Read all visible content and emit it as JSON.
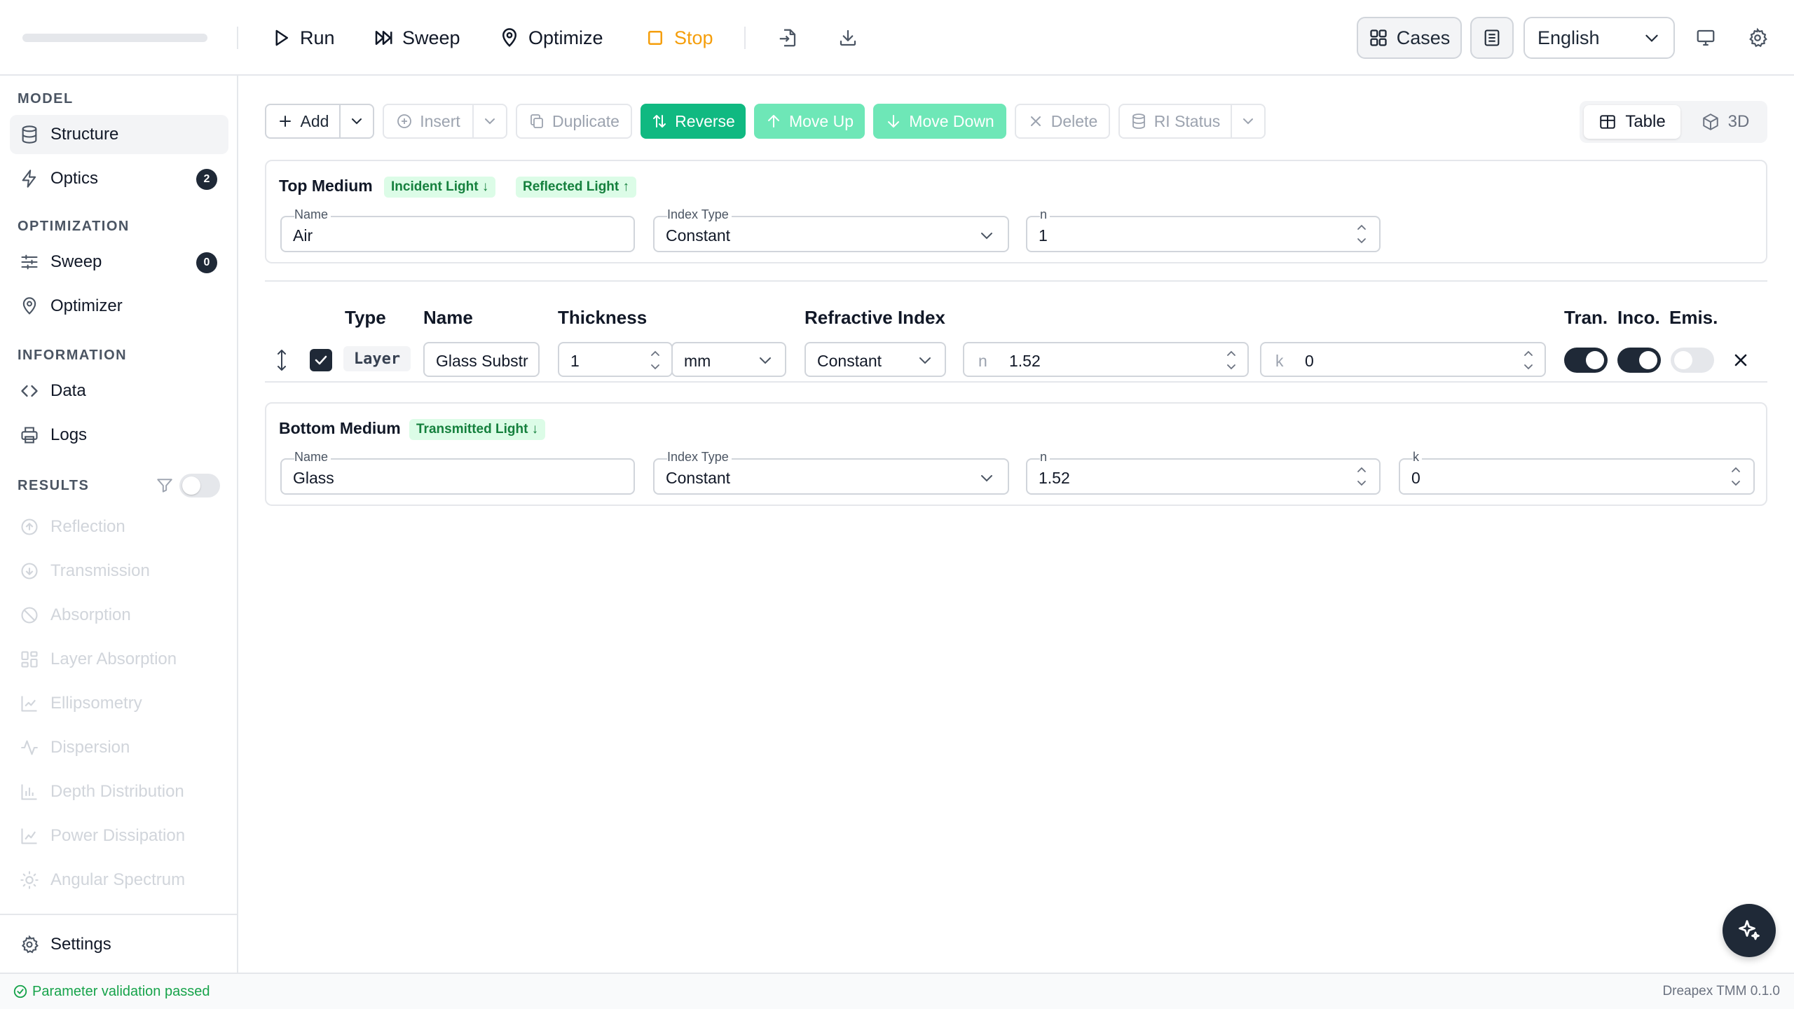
{
  "toolbar": {
    "run": "Run",
    "sweep": "Sweep",
    "optimize": "Optimize",
    "stop": "Stop",
    "cases": "Cases",
    "language": "English"
  },
  "sidebar": {
    "model_header": "MODEL",
    "optimization_header": "OPTIMIZATION",
    "information_header": "INFORMATION",
    "results_header": "RESULTS",
    "items": {
      "structure": "Structure",
      "optics": "Optics",
      "optics_badge": "2",
      "sweep": "Sweep",
      "sweep_badge": "0",
      "optimizer": "Optimizer",
      "data": "Data",
      "logs": "Logs"
    },
    "results": [
      "Reflection",
      "Transmission",
      "Absorption",
      "Layer Absorption",
      "Ellipsometry",
      "Dispersion",
      "Depth Distribution",
      "Power Dissipation",
      "Angular Spectrum"
    ],
    "settings": "Settings"
  },
  "actions": {
    "add": "Add",
    "insert": "Insert",
    "duplicate": "Duplicate",
    "reverse": "Reverse",
    "move_up": "Move Up",
    "move_down": "Move Down",
    "delete": "Delete",
    "ri_status": "RI Status",
    "view_table": "Table",
    "view_3d": "3D"
  },
  "top_medium": {
    "title": "Top Medium",
    "badge_incident": "Incident Light ↓",
    "badge_reflected": "Reflected Light ↑",
    "name_label": "Name",
    "name_value": "Air",
    "index_type_label": "Index Type",
    "index_type_value": "Constant",
    "n_label": "n",
    "n_value": "1"
  },
  "table": {
    "headers": {
      "type": "Type",
      "name": "Name",
      "thickness": "Thickness",
      "refractive_index": "Refractive Index",
      "tran": "Tran.",
      "inco": "Inco.",
      "emis": "Emis."
    },
    "row": {
      "type": "Layer",
      "name": "Glass Substr",
      "thickness": "1",
      "unit": "mm",
      "index_type": "Constant",
      "n_prefix": "n",
      "n_value": "1.52",
      "k_prefix": "k",
      "k_value": "0",
      "tran": true,
      "inco": true,
      "emis": false
    }
  },
  "bottom_medium": {
    "title": "Bottom Medium",
    "badge_transmitted": "Transmitted Light ↓",
    "name_label": "Name",
    "name_value": "Glass",
    "index_type_label": "Index Type",
    "index_type_value": "Constant",
    "n_label": "n",
    "n_value": "1.52",
    "k_label": "k",
    "k_value": "0"
  },
  "status": {
    "message": "Parameter validation passed",
    "version": "Dreapex TMM 0.1.0"
  },
  "colors": {
    "accent_green": "#10b981",
    "accent_green_light": "#6ee7b7",
    "stop_orange": "#f59e0b",
    "dark": "#1f2937"
  }
}
